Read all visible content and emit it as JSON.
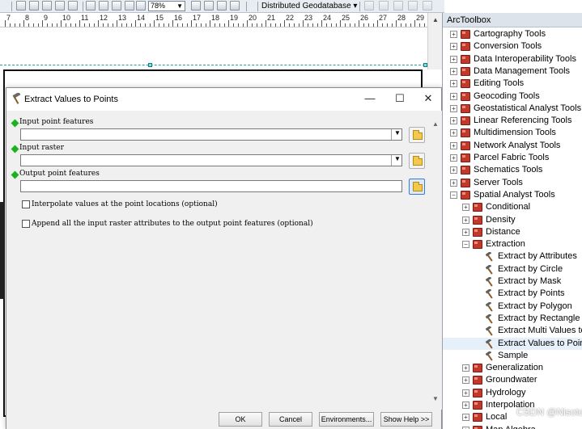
{
  "toolbar": {
    "zoom_value": "78%",
    "geodatabase_dropdown": "Distributed Geodatabase"
  },
  "ruler": {
    "numbers": [
      "7",
      "8",
      "9",
      "10",
      "11",
      "12",
      "13",
      "14",
      "15",
      "16",
      "17",
      "18",
      "19",
      "20",
      "21",
      "22",
      "23",
      "24",
      "25",
      "26",
      "27",
      "28",
      "29"
    ]
  },
  "dialog": {
    "title": "Extract Values to Points",
    "params": {
      "input_points_label": "Input point features",
      "input_points_value": "",
      "input_raster_label": "Input raster",
      "input_raster_value": "",
      "output_points_label": "Output point features",
      "output_points_value": ""
    },
    "options": {
      "interpolate_label": "Interpolate values at the point locations (optional)",
      "interpolate_checked": false,
      "append_label": "Append all the input raster attributes to the output point features (optional)",
      "append_checked": false
    },
    "buttons": {
      "ok": "OK",
      "cancel": "Cancel",
      "environments": "Environments...",
      "show_help": "Show Help >>"
    }
  },
  "toolbox": {
    "title": "ArcToolbox",
    "items": [
      "Cartography Tools",
      "Conversion Tools",
      "Data Interoperability Tools",
      "Data Management Tools",
      "Editing Tools",
      "Geocoding Tools",
      "Geostatistical Analyst Tools",
      "Linear Referencing Tools",
      "Multidimension Tools",
      "Network Analyst Tools",
      "Parcel Fabric Tools",
      "Schematics Tools",
      "Server Tools",
      "Spatial Analyst Tools"
    ],
    "spatial_analyst": [
      "Conditional",
      "Density",
      "Distance",
      "Extraction"
    ],
    "extraction_tools": [
      "Extract by Attributes",
      "Extract by Circle",
      "Extract by Mask",
      "Extract by Points",
      "Extract by Polygon",
      "Extract by Rectangle",
      "Extract Multi Values to",
      "Extract Values to Points",
      "Sample"
    ],
    "more_toolsets": [
      "Generalization",
      "Groundwater",
      "Hydrology",
      "Interpolation",
      "Local",
      "Map Algebra"
    ],
    "selected_tool": "Extract Values to Points"
  },
  "watermark": "CSDN @Nisotope",
  "colors": {
    "required_param_marker": "#1bb31b",
    "toolbox_icon": "#c0392b",
    "selection_highlight": "#e5f0fb"
  }
}
